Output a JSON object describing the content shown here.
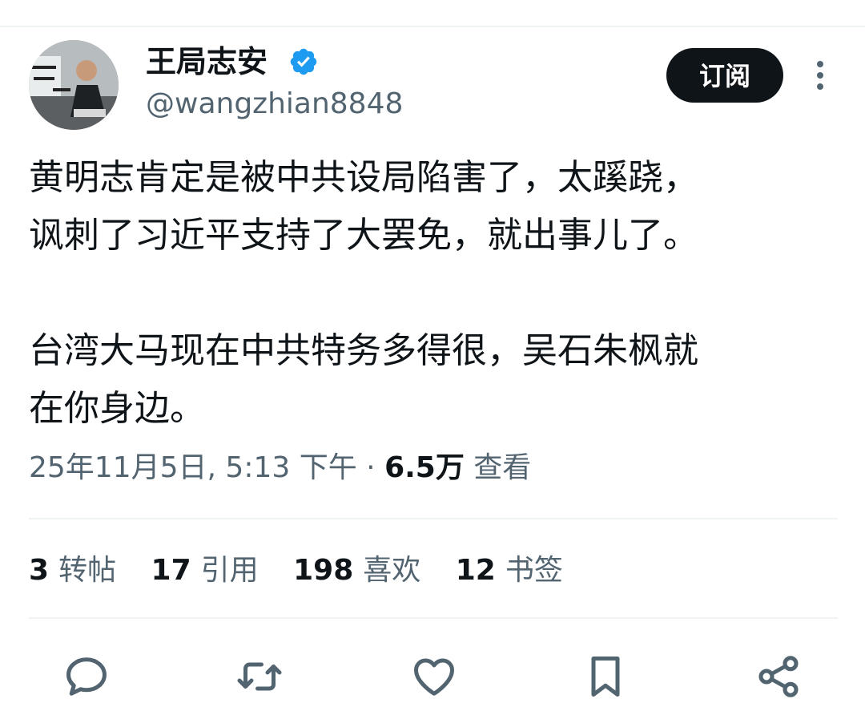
{
  "user": {
    "display_name": "王局志安",
    "handle": "@wangzhian8848",
    "verified_icon": "verified-badge-icon"
  },
  "header": {
    "subscribe_label": "订阅",
    "more_icon": "more-vertical-icon"
  },
  "tweet": {
    "paragraphs": [
      "黄明志肯定是被中共设局陷害了，太蹊跷，讽刺了习近平支持了大罢免，就出事儿了。",
      "台湾大马现在中共特务多得很，吴石朱枫就在你身边。"
    ],
    "line1": "黄明志肯定是被中共设局陷害了，太蹊跷，",
    "line2": "讽刺了习近平支持了大罢免，就出事儿了。",
    "line3": "台湾大马现在中共特务多得很，吴石朱枫就",
    "line4": "在你身边。"
  },
  "meta": {
    "timestamp": "25年11月5日, 5:13 下午",
    "separator": "·",
    "views_count": "6.5万",
    "views_label": "查看"
  },
  "stats": [
    {
      "count": "3",
      "label": "转帖"
    },
    {
      "count": "17",
      "label": "引用"
    },
    {
      "count": "198",
      "label": "喜欢"
    },
    {
      "count": "12",
      "label": "书签"
    }
  ],
  "actions": [
    "reply-icon",
    "repost-icon",
    "like-icon",
    "bookmark-icon",
    "share-icon"
  ],
  "colors": {
    "text": "#0f1419",
    "secondary": "#536471",
    "verified": "#1d9bf0",
    "divider": "#eff3f4"
  }
}
